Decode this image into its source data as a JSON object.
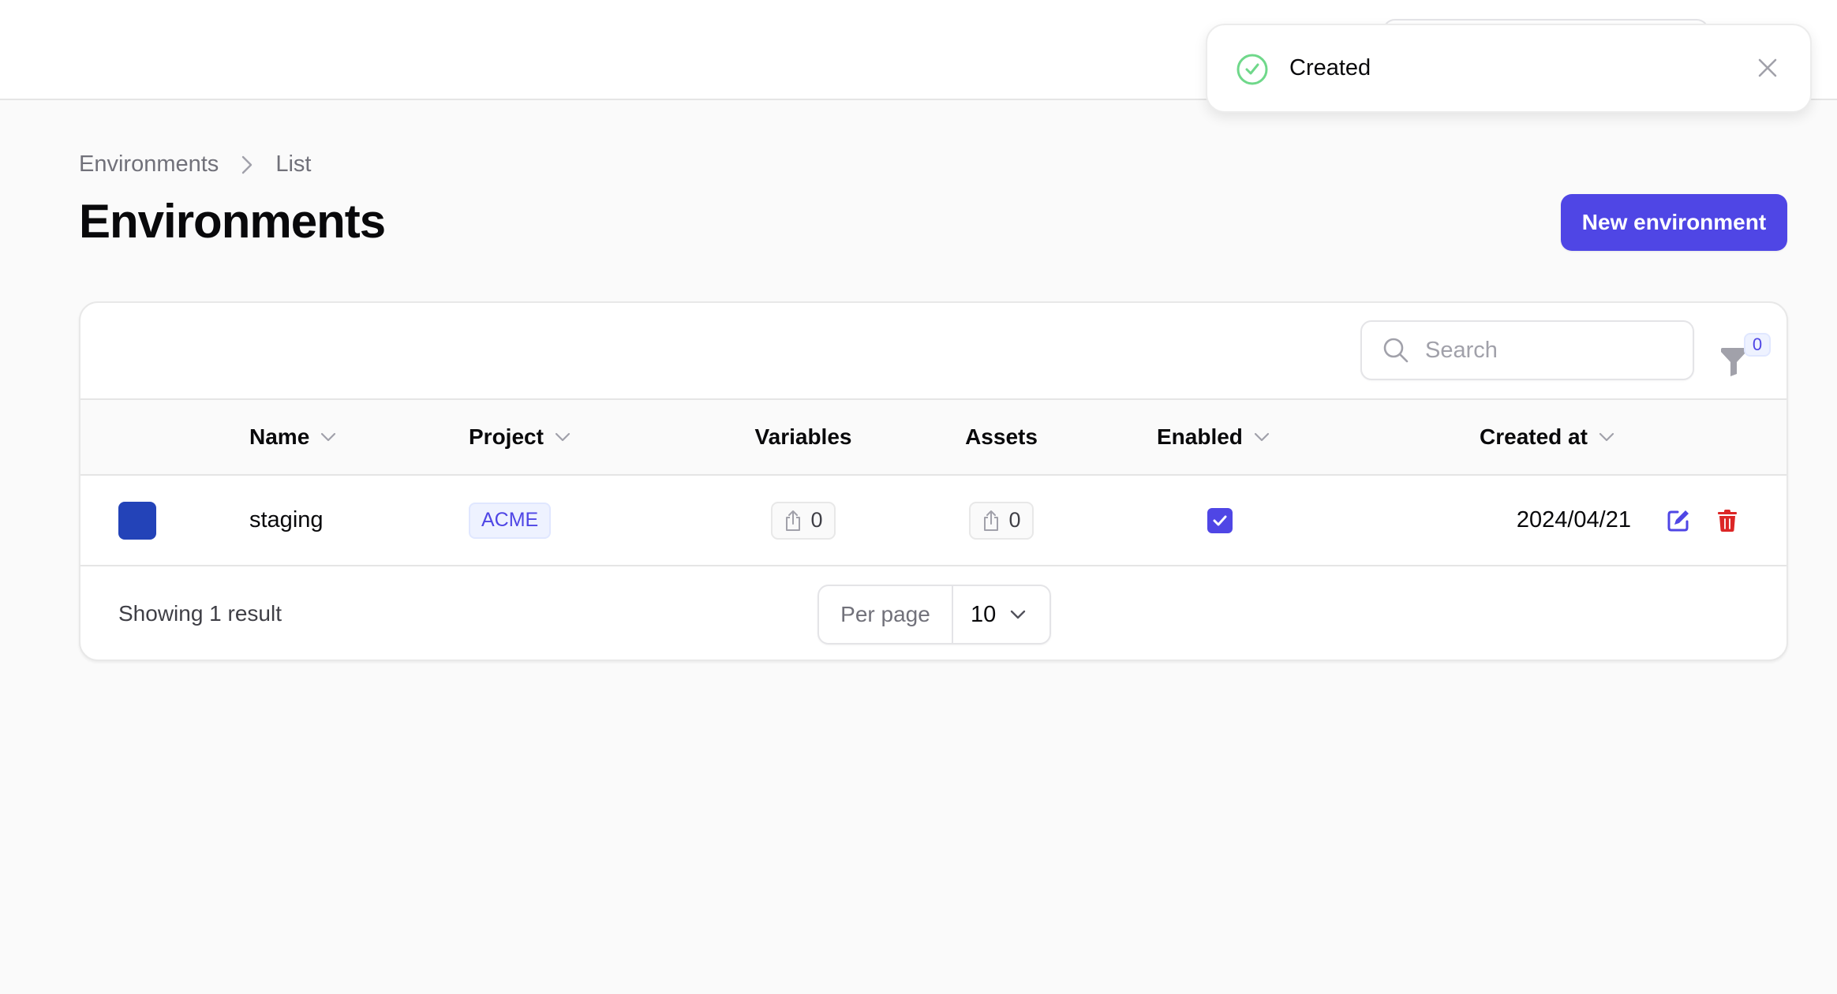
{
  "topbar": {},
  "breadcrumb": {
    "items": [
      "Environments",
      "List"
    ]
  },
  "page": {
    "title": "Environments",
    "new_button_label": "New environment"
  },
  "toolbar": {
    "search_placeholder": "Search",
    "search_value": "",
    "filter_count": "0"
  },
  "table": {
    "columns": [
      {
        "label": "",
        "sortable": false
      },
      {
        "label": "Name",
        "sortable": true
      },
      {
        "label": "Project",
        "sortable": true
      },
      {
        "label": "Variables",
        "sortable": false
      },
      {
        "label": "Assets",
        "sortable": false
      },
      {
        "label": "Enabled",
        "sortable": true
      },
      {
        "label": "Created at",
        "sortable": true
      }
    ],
    "rows": [
      {
        "color": "#2343b8",
        "name": "staging",
        "project": "ACME",
        "variables": "0",
        "assets": "0",
        "enabled": true,
        "created_at": "2024/04/21"
      }
    ]
  },
  "footer": {
    "result_text": "Showing 1 result",
    "per_page_label": "Per page",
    "per_page_value": "10"
  },
  "toast": {
    "message": "Created",
    "status": "success"
  },
  "colors": {
    "accent": "#4f46e5",
    "success": "#6fd88a",
    "danger": "#dc2626"
  }
}
